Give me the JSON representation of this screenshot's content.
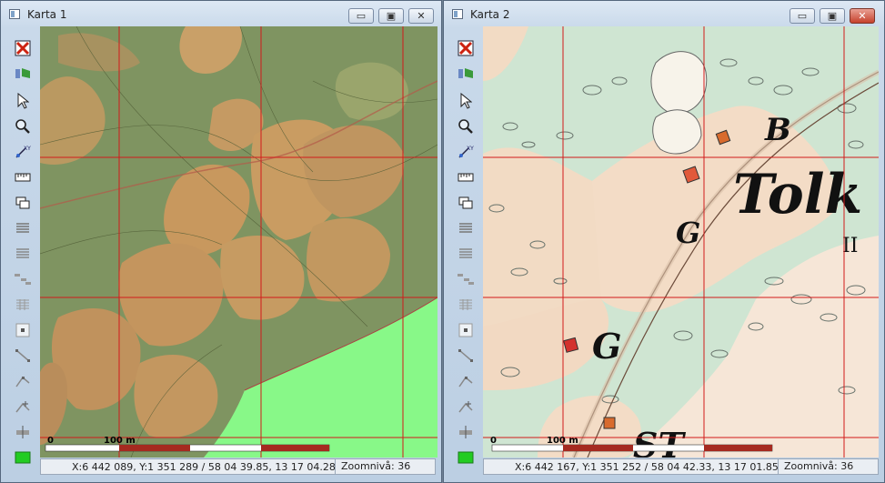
{
  "windows": [
    {
      "title": "Karta 1",
      "status": {
        "coords": "X:6 442 089, Y:1 351 289 / 58 04 39.85, 13 17 04.28",
        "zoom": "Zoomnivå: 36"
      },
      "scale": {
        "zero": "0",
        "label": "100 m"
      },
      "controls": {
        "minimize": "▭",
        "maximize": "▣",
        "close": "✕"
      }
    },
    {
      "title": "Karta 2",
      "status": {
        "coords": "X:6 442 167, Y:1 351 252 / 58 04 42.33, 13 17 01.85",
        "zoom": "Zoomnivå: 36"
      },
      "scale": {
        "zero": "0",
        "label": "100 m"
      },
      "controls": {
        "minimize": "▭",
        "maximize": "▣",
        "close": "✕"
      }
    }
  ],
  "map2_labels": {
    "b": "B",
    "tolk": "Tolk",
    "g1": "G",
    "g2": "G",
    "roman": "II",
    "st": "ST"
  },
  "toolbar_icons": [
    "close-layer-icon",
    "layers-icon",
    "pointer-icon",
    "zoom-icon",
    "xy-coordinate-icon",
    "measure-icon",
    "copy-icon",
    "list-icon",
    "table-icon",
    "tree-icon",
    "grid-icon",
    "point-icon",
    "line-icon",
    "line-edit-icon",
    "line-add-icon",
    "split-icon",
    "color-swatch-icon"
  ],
  "colors": {
    "grid": "#d21a1a",
    "swatch": "#22cc22",
    "map1_base": "#8a9a62",
    "map2_base": "#f3dcc6"
  }
}
